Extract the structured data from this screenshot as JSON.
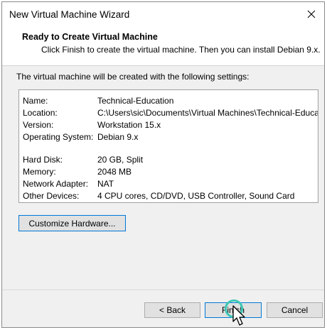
{
  "window": {
    "title": "New Virtual Machine Wizard"
  },
  "header": {
    "title": "Ready to Create Virtual Machine",
    "subtitle": "Click Finish to create the virtual machine. Then you can install Debian 9.x."
  },
  "body": {
    "intro": "The virtual machine will be created with the following settings:"
  },
  "settings": {
    "name_label": "Name:",
    "name_value": "Technical-Education",
    "location_label": "Location:",
    "location_value": "C:\\Users\\sic\\Documents\\Virtual Machines\\Technical-Educat...",
    "version_label": "Version:",
    "version_value": "Workstation 15.x",
    "os_label": "Operating System:",
    "os_value": "Debian 9.x",
    "disk_label": "Hard Disk:",
    "disk_value": "20 GB, Split",
    "memory_label": "Memory:",
    "memory_value": "2048 MB",
    "network_label": "Network Adapter:",
    "network_value": "NAT",
    "devices_label": "Other Devices:",
    "devices_value": "4 CPU cores, CD/DVD, USB Controller, Sound Card"
  },
  "buttons": {
    "customize": "Customize Hardware...",
    "back": "< Back",
    "finish": "Finish",
    "cancel": "Cancel"
  },
  "icons": {
    "close": "close-icon",
    "cursor": "mouse-pointer-icon"
  },
  "colors": {
    "focus_border": "#0078d7",
    "click_highlight": "#3cc7b5"
  }
}
